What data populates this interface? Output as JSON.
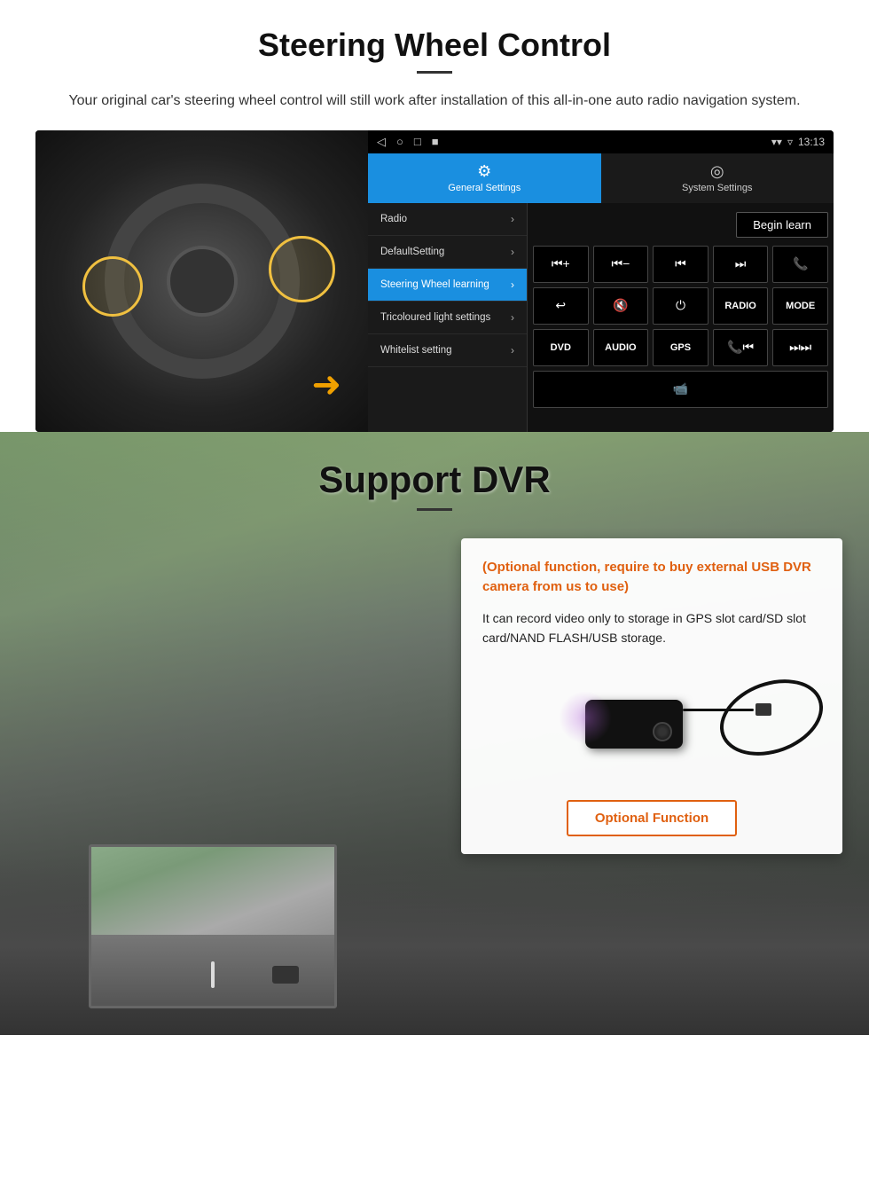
{
  "page": {
    "steering_section": {
      "title": "Steering Wheel Control",
      "description": "Your original car's steering wheel control will still work after installation of this all-in-one auto radio navigation system.",
      "android_ui": {
        "statusbar": {
          "time": "13:13",
          "nav_items": [
            "◁",
            "○",
            "□",
            "■"
          ]
        },
        "tabs": [
          {
            "label": "General Settings",
            "icon": "⚙",
            "active": true
          },
          {
            "label": "System Settings",
            "icon": "🌐",
            "active": false
          }
        ],
        "menu_items": [
          {
            "label": "Radio",
            "active": false
          },
          {
            "label": "DefaultSetting",
            "active": false
          },
          {
            "label": "Steering Wheel learning",
            "active": true
          },
          {
            "label": "Tricoloured light settings",
            "active": false
          },
          {
            "label": "Whitelist setting",
            "active": false
          }
        ],
        "begin_learn_label": "Begin learn",
        "control_buttons": [
          [
            "⏮+",
            "⏮-",
            "⏮⏮",
            "⏭⏭",
            "📞"
          ],
          [
            "↩",
            "🔇x",
            "⏻",
            "RADIO",
            "MODE"
          ],
          [
            "DVD",
            "AUDIO",
            "GPS",
            "📞⏮",
            "⏭⏭"
          ]
        ],
        "extra_btn": "📹"
      }
    },
    "dvr_section": {
      "title": "Support DVR",
      "optional_text": "(Optional function, require to buy external USB DVR camera from us to use)",
      "description": "It can record video only to storage in GPS slot card/SD slot card/NAND FLASH/USB storage.",
      "optional_function_label": "Optional Function"
    }
  }
}
